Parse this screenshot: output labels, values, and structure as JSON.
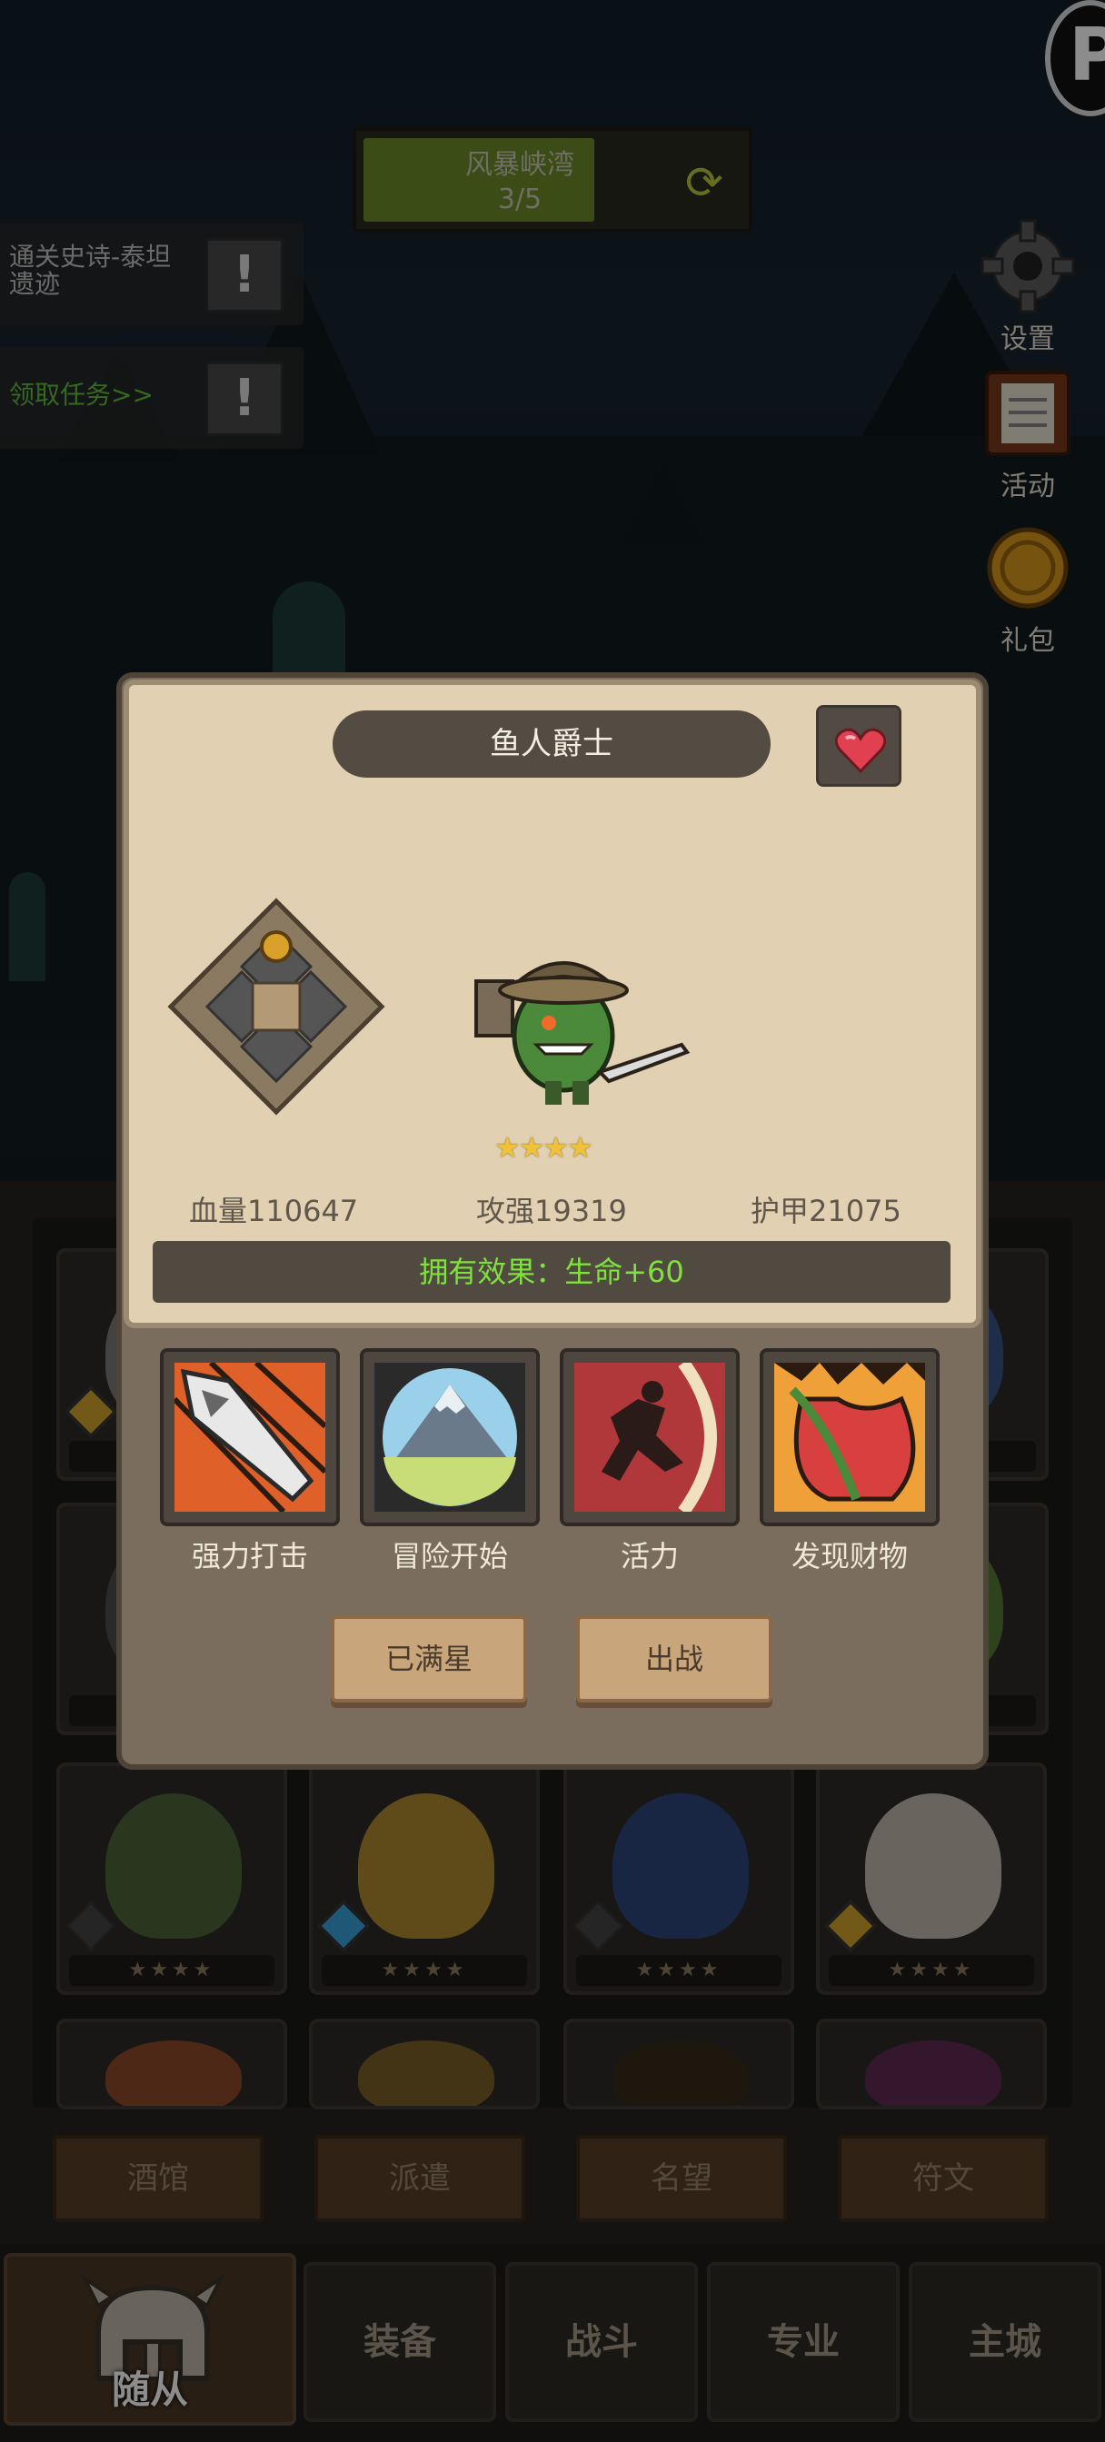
{
  "stage": {
    "name": "风暴峡湾",
    "progress_text": "3/5",
    "progress": 0.6
  },
  "quests": [
    {
      "text": "通关史诗-泰坦遗迹"
    },
    {
      "text": "领取任务>>"
    }
  ],
  "quest_alert": "!",
  "side_menu": {
    "settings": "设置",
    "activity": "活动",
    "gift": "礼包"
  },
  "hero": {
    "name": "鱼人爵士",
    "stars": 4,
    "stars_text": "★★★★",
    "hp": "血量110647",
    "attack": "攻强19319",
    "armor": "护甲21075",
    "effect": "拥有效果：生命+60"
  },
  "skills": [
    {
      "label": "强力打击"
    },
    {
      "label": "冒险开始"
    },
    {
      "label": "活力"
    },
    {
      "label": "发现财物"
    }
  ],
  "actions": {
    "max_star": "已满星",
    "deploy": "出战"
  },
  "sub_tabs": [
    "酒馆",
    "派遣",
    "名望",
    "符文"
  ],
  "nav": {
    "followers": "随从",
    "equipment": "装备",
    "battle": "战斗",
    "profession": "专业",
    "main_city": "主城"
  },
  "colors": {
    "effect_text": "#7ee23c",
    "star": "#f0c23a",
    "paper": "#e1d0b1",
    "frame": "#7a6d5e"
  }
}
